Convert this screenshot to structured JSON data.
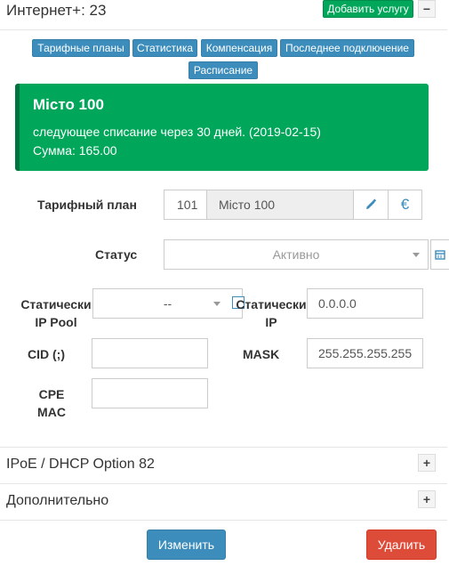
{
  "header": {
    "title": "Интернет+: 23",
    "add_service_label": "Добавить услугу",
    "collapse_label": "−"
  },
  "tabs": [
    {
      "label": "Тарифные планы"
    },
    {
      "label": "Статистика"
    },
    {
      "label": "Компенсация"
    },
    {
      "label": "Последнее подключение"
    },
    {
      "label": "Расписание"
    }
  ],
  "alert": {
    "title": "Місто 100",
    "next_charge": "следующее списание через 30 дней. (2019-02-15)",
    "amount": "Сумма: 165.00"
  },
  "form": {
    "tariff_label": "Тарифный план",
    "tariff_id": "101",
    "tariff_name": "Місто 100",
    "currency_icon": "€",
    "status_label": "Статус",
    "status_value": "Активно",
    "static_pool_label_1": "Статически",
    "static_pool_label_2": "IP Pool",
    "static_pool_value": "--",
    "static_ip_label_1": "Статически",
    "static_ip_label_2": "IP",
    "static_ip_value": "0.0.0.0",
    "cid_label": "CID (;)",
    "cid_value": "",
    "mask_label": "MASK",
    "mask_value": "255.255.255.255",
    "cpe_label_1": "CPE",
    "cpe_label_2": "MAC",
    "cpe_value": ""
  },
  "sections": [
    {
      "title": "IPoE / DHCP Option 82",
      "toggle": "+"
    },
    {
      "title": "Дополнительно",
      "toggle": "+"
    }
  ],
  "footer": {
    "change_label": "Изменить",
    "delete_label": "Удалить"
  },
  "colors": {
    "primary": "#3c8dbc",
    "success": "#00a65a",
    "danger": "#dd4b39"
  }
}
